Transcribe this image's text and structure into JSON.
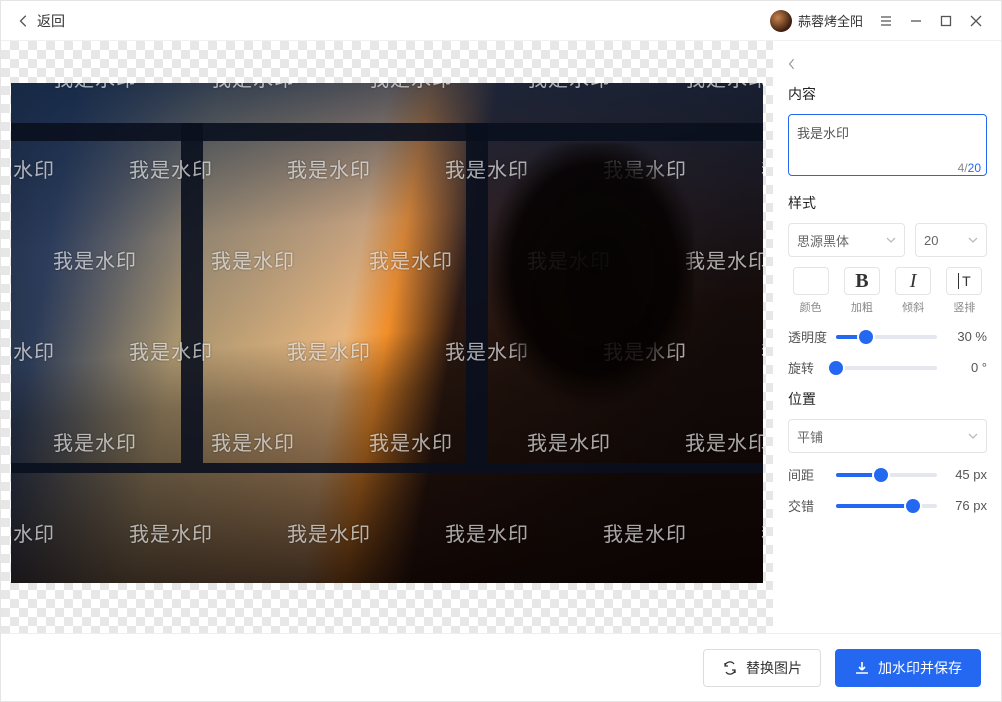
{
  "titlebar": {
    "back": "返回",
    "username": "蒜蓉烤全阳"
  },
  "watermark_text": "我是水印",
  "side": {
    "content_label": "内容",
    "input_value": "我是水印",
    "char_count": "4",
    "char_max": "20",
    "style_label": "样式",
    "font_select": "思源黑体",
    "size_select": "20",
    "btns": {
      "color": "颜色",
      "bold": "加粗",
      "italic": "倾斜",
      "vertical": "竖排"
    },
    "opacity": {
      "label": "透明度",
      "value": "30 %",
      "pct": 30
    },
    "rotate": {
      "label": "旋转",
      "value": "0  °",
      "pct": 0
    },
    "position_label": "位置",
    "position_select": "平铺",
    "spacing": {
      "label": "间距",
      "value": "45 px",
      "pct": 45
    },
    "stagger": {
      "label": "交错",
      "value": "76 px",
      "pct": 76
    }
  },
  "footer": {
    "replace": "替换图片",
    "save": "加水印并保存"
  }
}
